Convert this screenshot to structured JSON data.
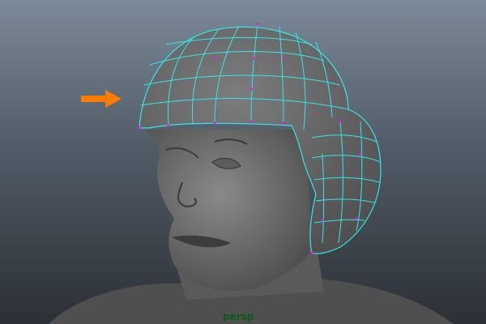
{
  "viewport": {
    "camera_label": "persp",
    "colors": {
      "wireframe": "#33e6f0",
      "vertex": "#e020e0",
      "arrow": "#ff7a00",
      "camera_label": "#0a5a1e"
    }
  }
}
